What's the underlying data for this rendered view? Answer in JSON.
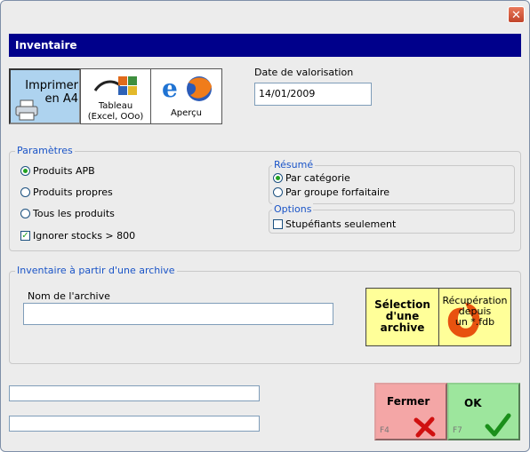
{
  "window": {
    "title": "Inventaire"
  },
  "toolbar": {
    "print_line1": "Imprimer",
    "print_line2": "en A4",
    "tableau_line1": "Tableau",
    "tableau_line2": "(Excel, OOo)",
    "apercu_label": "Aperçu"
  },
  "valuation": {
    "label": "Date de valorisation",
    "value": "14/01/2009"
  },
  "parametres": {
    "legend": "Paramètres",
    "radios": [
      "Produits APB",
      "Produits propres",
      "Tous les produits"
    ],
    "selected": "Produits APB",
    "ignore_stocks_label": "Ignorer stocks > 800",
    "ignore_stocks_checked": true
  },
  "resume": {
    "legend": "Résumé",
    "radios": [
      "Par catégorie",
      "Par groupe forfaitaire"
    ],
    "selected": "Par catégorie"
  },
  "options": {
    "legend": "Options",
    "stup_label": "Stupéfiants seulement",
    "stup_checked": false
  },
  "archive": {
    "legend": "Inventaire à partir d'une archive",
    "name_label": "Nom de l'archive",
    "name_value": "",
    "select_btn": [
      "Sélection",
      "d'une",
      "archive"
    ],
    "recup_btn": [
      "Récupération",
      "depuis",
      "un *.fdb"
    ]
  },
  "footer": {
    "fermer_label": "Fermer",
    "fermer_key": "F4",
    "ok_label": "OK",
    "ok_key": "F7",
    "status1": "",
    "status2": ""
  },
  "colors": {
    "title_bg": "#00008b",
    "legend": "#1a54c7",
    "yellow_btn": "#ffff99",
    "fermer_bg": "#f4a6a6",
    "ok_bg": "#9de69d"
  }
}
